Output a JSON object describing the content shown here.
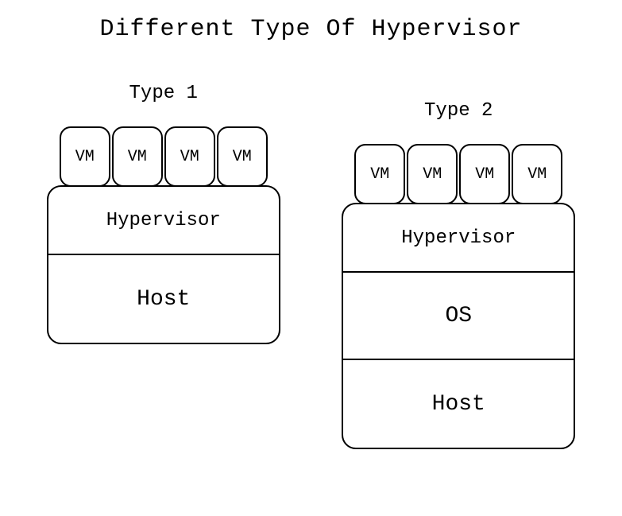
{
  "title": "Different Type Of Hypervisor",
  "type1": {
    "title": "Type 1",
    "vms": [
      "VM",
      "VM",
      "VM",
      "VM"
    ],
    "layers": {
      "hypervisor": "Hypervisor",
      "host": "Host"
    }
  },
  "type2": {
    "title": "Type 2",
    "vms": [
      "VM",
      "VM",
      "VM",
      "VM"
    ],
    "layers": {
      "hypervisor": "Hypervisor",
      "os": "OS",
      "host": "Host"
    }
  }
}
